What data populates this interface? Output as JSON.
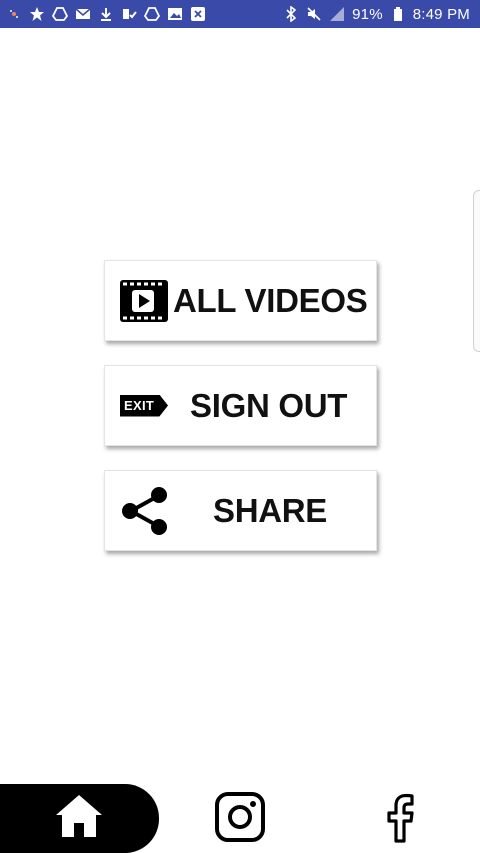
{
  "status_bar": {
    "left_icons": [
      "notification-dot-icon",
      "star-icon",
      "drive-icon",
      "gmail-icon",
      "download-icon",
      "checklist-icon",
      "drive-icon",
      "image-icon",
      "close-box-icon"
    ],
    "right_icons": [
      "bluetooth-icon",
      "mute-icon",
      "signal-icon",
      "battery-icon"
    ],
    "battery": "91%",
    "time": "8:49 PM",
    "color": "#3a4aa8"
  },
  "menu": {
    "items": [
      {
        "label": "ALL VIDEOS",
        "icon": "video-play-icon"
      },
      {
        "label": "SIGN OUT",
        "icon": "exit-icon",
        "icon_text": "EXIT"
      },
      {
        "label": "SHARE",
        "icon": "share-icon"
      }
    ]
  },
  "bottom_nav": {
    "items": [
      {
        "name": "home",
        "icon": "home-icon",
        "active": true
      },
      {
        "name": "instagram",
        "icon": "instagram-icon"
      },
      {
        "name": "facebook",
        "icon": "facebook-icon"
      }
    ],
    "active_color": "#000000"
  }
}
